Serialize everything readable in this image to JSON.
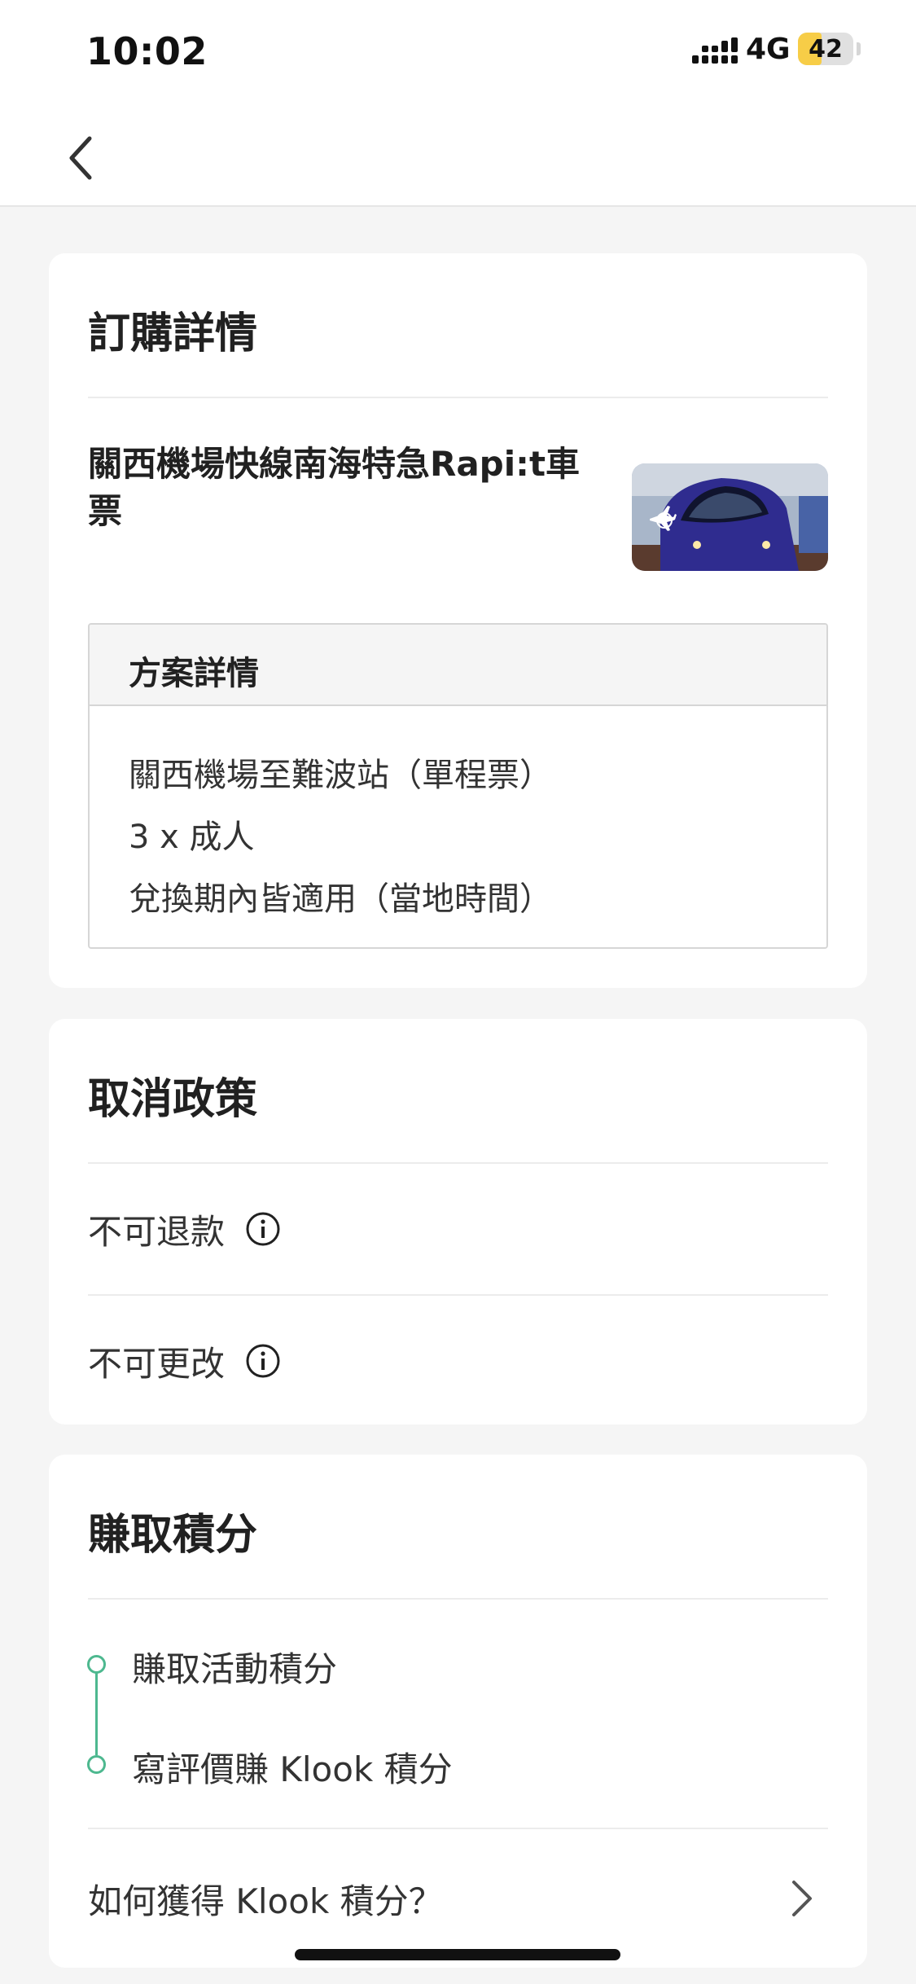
{
  "status_bar": {
    "time": "10:02",
    "network": "4G",
    "battery": "42",
    "battery_level": 0.42,
    "battery_color": "#f7cd47",
    "icons": [
      "signal-icon",
      "battery-icon"
    ]
  },
  "nav": {
    "back_icon": "chevron-left-icon"
  },
  "order_details": {
    "title": "訂購詳情",
    "product_name": "關西機場快線南海特急Rapi:t車票",
    "product_image": "train-photo",
    "plan": {
      "title": "方案詳情",
      "lines": [
        "關西機場至難波站（單程票）",
        "3 x 成人",
        "兌換期內皆適用（當地時間）"
      ]
    }
  },
  "cancellation": {
    "title": "取消政策",
    "items": [
      {
        "label": "不可退款",
        "icon": "info-icon"
      },
      {
        "label": "不可更改",
        "icon": "info-icon"
      }
    ]
  },
  "credits": {
    "title": "賺取積分",
    "items": [
      "賺取活動積分",
      "寫評價賺 Klook 積分"
    ],
    "how_label": "如何獲得 Klook 積分？",
    "how_icon": "chevron-right-icon",
    "accent_color": "#4db88f"
  }
}
